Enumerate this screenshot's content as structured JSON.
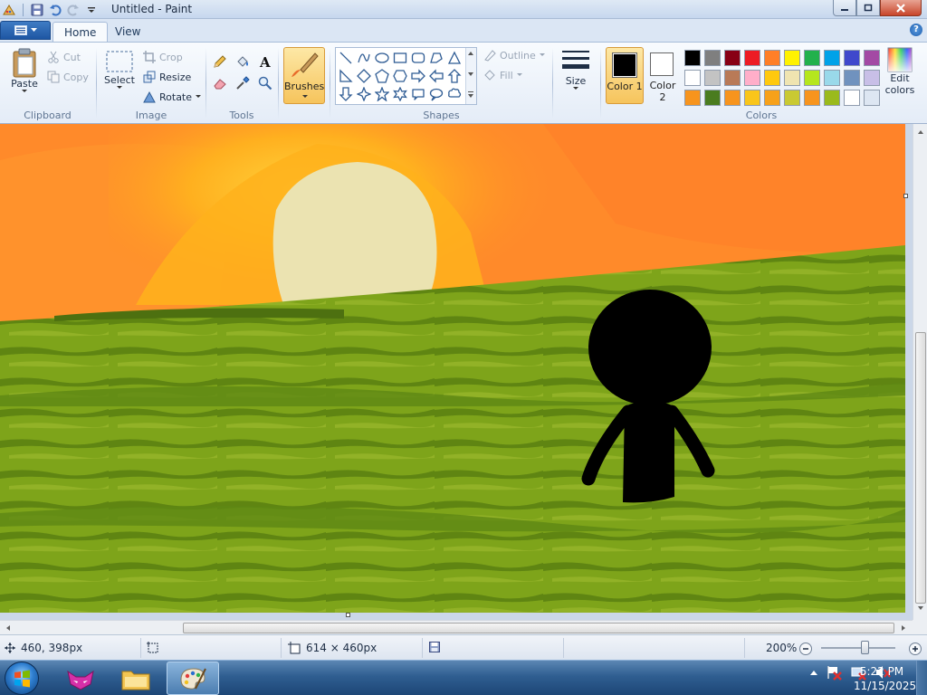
{
  "window": {
    "title": "Untitled - Paint"
  },
  "tabs": [
    {
      "label": "Home"
    },
    {
      "label": "View"
    }
  ],
  "clipboard": {
    "group_label": "Clipboard",
    "paste_label": "Paste",
    "cut_label": "Cut",
    "copy_label": "Copy"
  },
  "image": {
    "group_label": "Image",
    "select_label": "Select",
    "crop_label": "Crop",
    "resize_label": "Resize",
    "rotate_label": "Rotate"
  },
  "tools": {
    "group_label": "Tools",
    "items": [
      "pencil-icon",
      "fill-bucket-icon",
      "text-icon",
      "eraser-icon",
      "color-picker-icon",
      "magnifier-icon"
    ]
  },
  "brushes": {
    "label": "Brushes"
  },
  "shapes": {
    "group_label": "Shapes",
    "outline_label": "Outline",
    "fill_label": "Fill",
    "items": [
      "line",
      "curve",
      "oval",
      "rectangle",
      "rounded-rectangle",
      "polygon",
      "triangle",
      "right-triangle",
      "diamond",
      "pentagon",
      "hexagon",
      "right-arrow",
      "left-arrow",
      "up-arrow",
      "down-arrow",
      "four-point-star",
      "five-point-star",
      "six-point-star",
      "rounded-callout",
      "oval-callout",
      "cloud-callout"
    ]
  },
  "size": {
    "label": "Size"
  },
  "colors": {
    "group_label": "Colors",
    "color1_label": "Color 1",
    "color2_label": "Color 2",
    "edit_label": "Edit colors",
    "color1": "#000000",
    "color2": "#ffffff",
    "palette": [
      "#000000",
      "#7f7f7f",
      "#880015",
      "#ed1c24",
      "#ff7f27",
      "#fff200",
      "#22b14c",
      "#00a2e8",
      "#3f48cc",
      "#a349a4",
      "#ffffff",
      "#c3c3c3",
      "#b97a57",
      "#ffaec9",
      "#ffc90e",
      "#efe4b0",
      "#b5e61d",
      "#99d9ea",
      "#7092be",
      "#c8bfe7",
      "#f7941d",
      "#4a7c1f",
      "#f7941d",
      "#f9c51a",
      "#f7a11a",
      "#c9c932",
      "#f7941d",
      "#9aba1c",
      "#ffffff",
      "#dde6f2"
    ]
  },
  "status": {
    "cursor_pos": "460, 398px",
    "selection_size": "",
    "canvas_size": "614 × 460px",
    "zoom": "200%"
  },
  "taskbar": {
    "time": "5:22 PM",
    "date": "11/15/2025"
  }
}
